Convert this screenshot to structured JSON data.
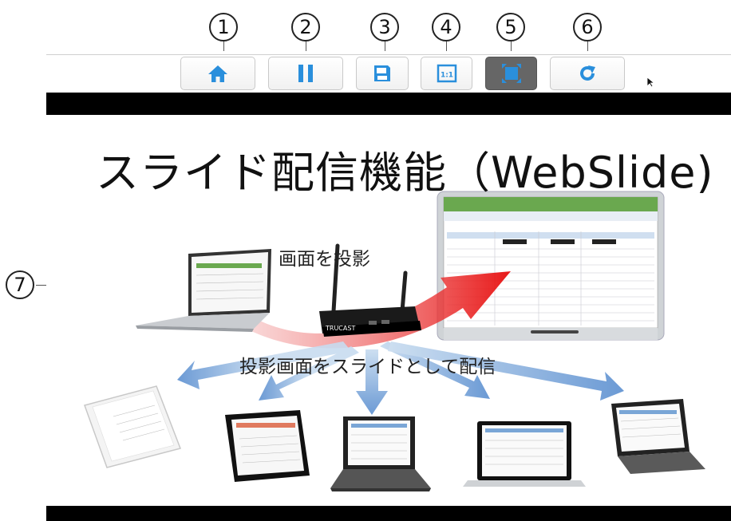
{
  "callouts": [
    "1",
    "2",
    "3",
    "4",
    "5",
    "6",
    "7"
  ],
  "toolbar": {
    "buttons": [
      {
        "icon": "home-icon",
        "active": false
      },
      {
        "icon": "pause-icon",
        "active": false
      },
      {
        "icon": "save-icon",
        "active": false
      },
      {
        "icon": "actual-size-icon",
        "icon_text": "1:1",
        "active": false
      },
      {
        "icon": "fit-screen-icon",
        "active": true
      },
      {
        "icon": "refresh-icon",
        "active": false
      }
    ],
    "accent": "#2a8fdc",
    "active_bg": "#666666"
  },
  "slide": {
    "title": "スライド配信機能（WebSlide)",
    "caption_projection": "画面を投影",
    "caption_distribution": "投影画面をスライドとして配信",
    "device_label": "TRUCAST"
  }
}
